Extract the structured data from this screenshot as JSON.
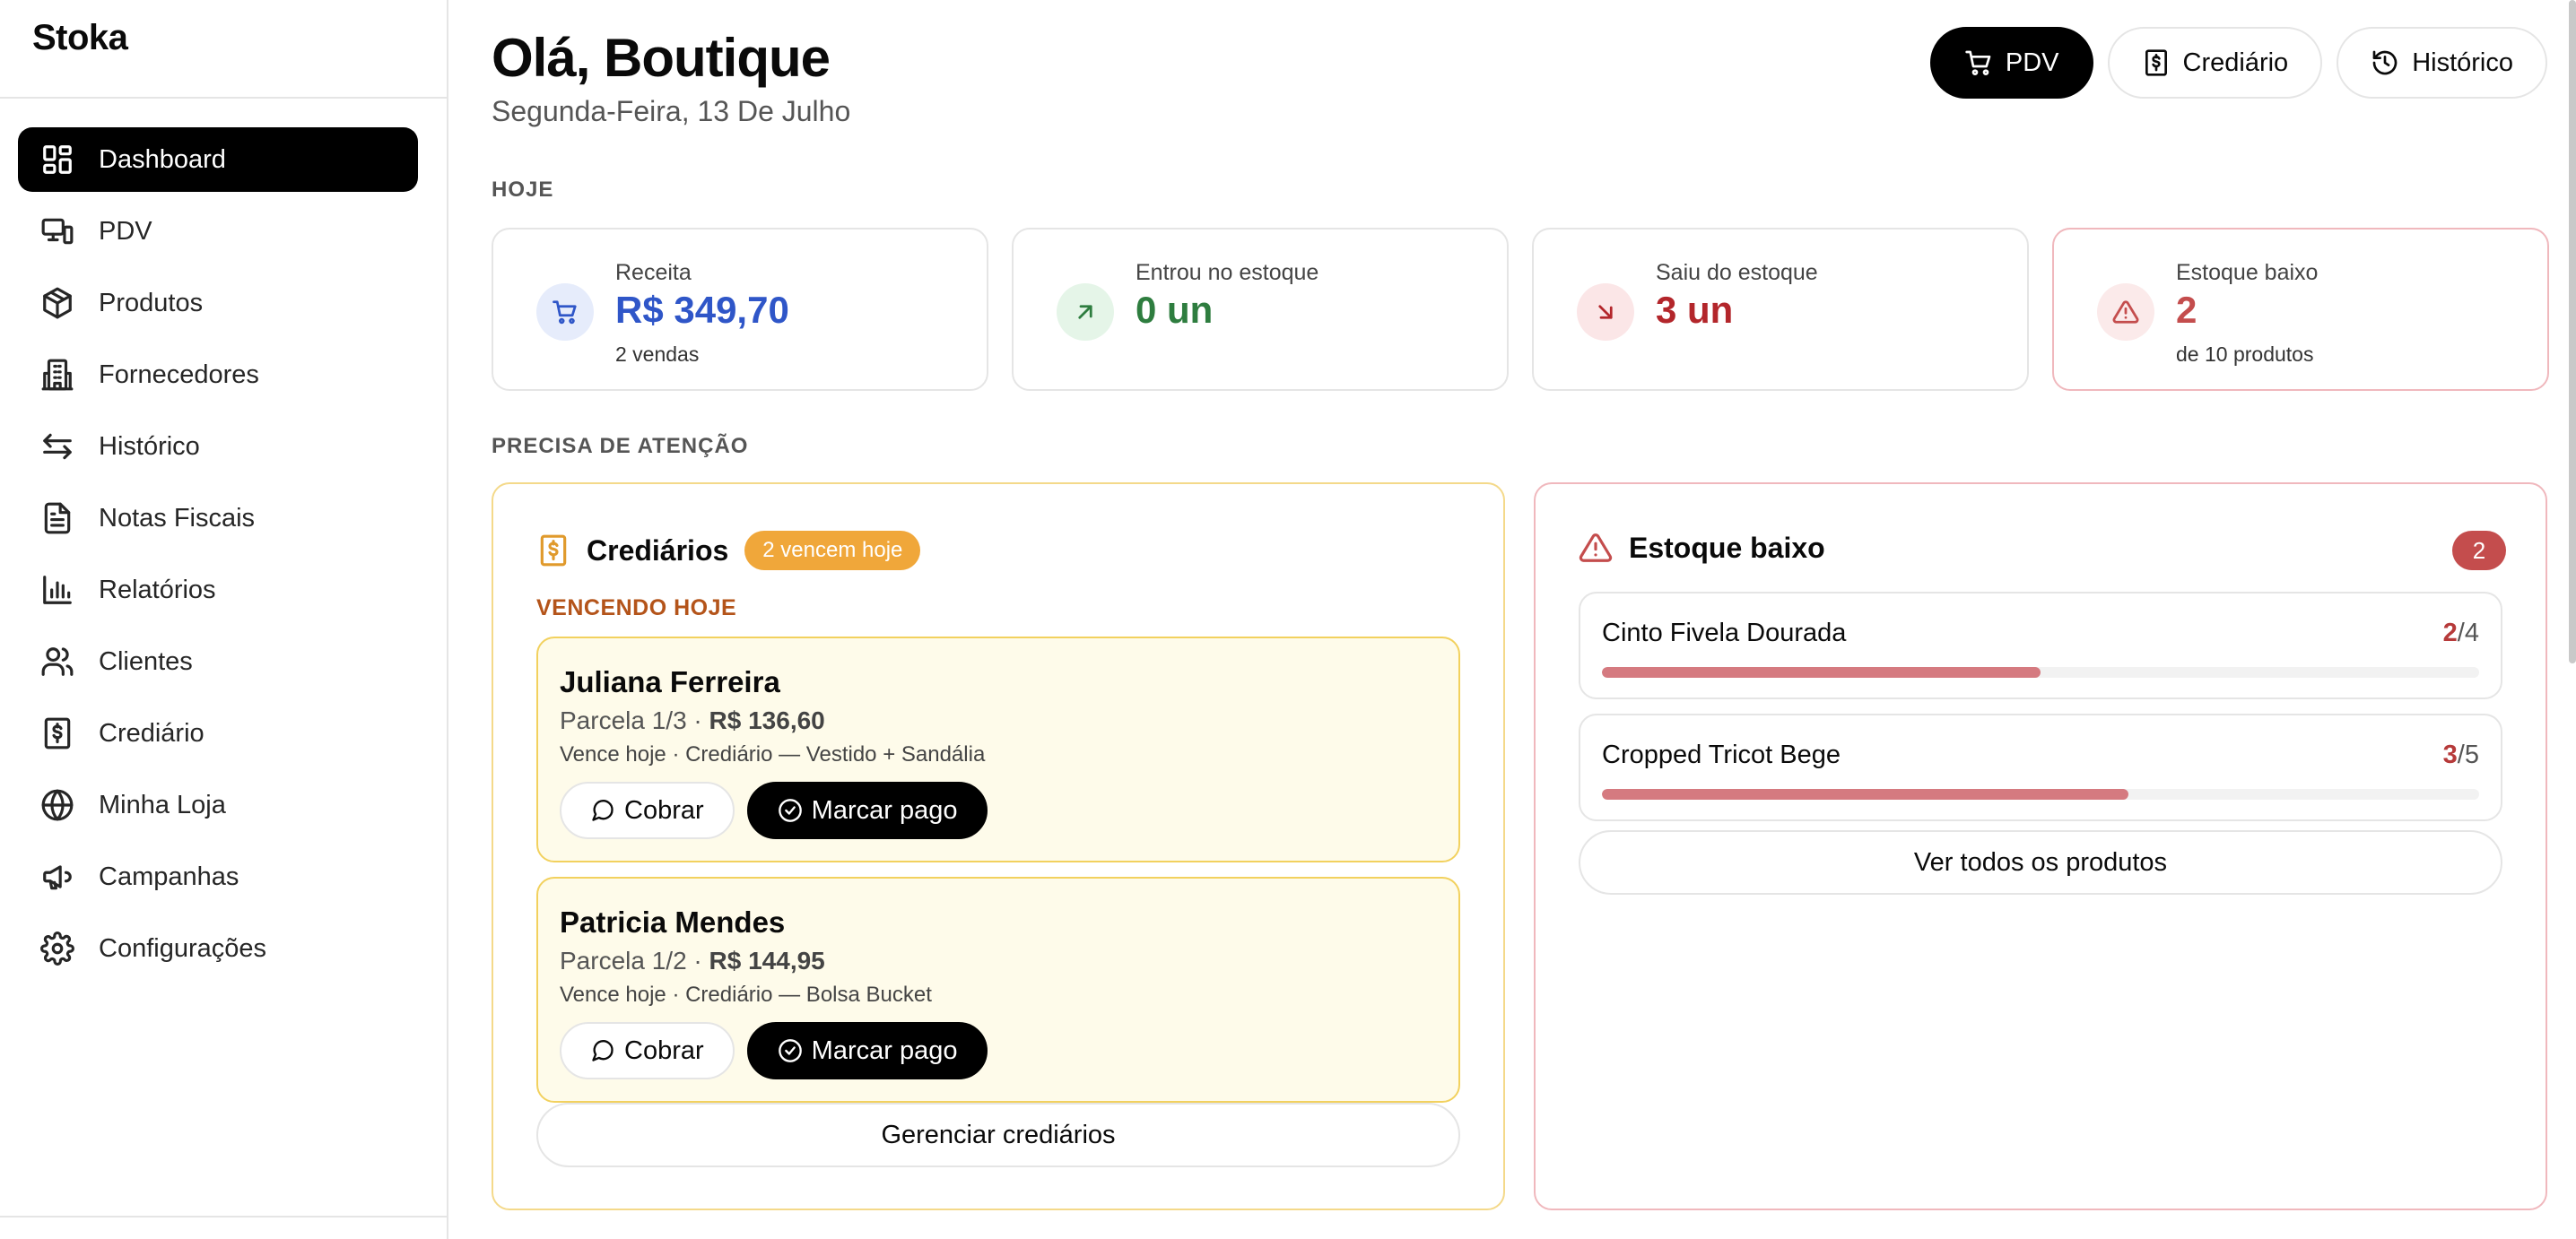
{
  "app": {
    "brand": "Stoka"
  },
  "sidebar": {
    "items": [
      {
        "label": "Dashboard",
        "icon": "dashboard-icon",
        "active": true
      },
      {
        "label": "PDV",
        "icon": "pos-icon"
      },
      {
        "label": "Produtos",
        "icon": "package-icon"
      },
      {
        "label": "Fornecedores",
        "icon": "building-icon"
      },
      {
        "label": "Histórico",
        "icon": "arrows-exchange-icon"
      },
      {
        "label": "Notas Fiscais",
        "icon": "document-icon"
      },
      {
        "label": "Relatórios",
        "icon": "bar-chart-icon"
      },
      {
        "label": "Clientes",
        "icon": "users-icon"
      },
      {
        "label": "Crediário",
        "icon": "receipt-dollar-icon"
      },
      {
        "label": "Minha Loja",
        "icon": "globe-icon"
      },
      {
        "label": "Campanhas",
        "icon": "megaphone-icon"
      },
      {
        "label": "Configurações",
        "icon": "gear-icon"
      }
    ]
  },
  "header": {
    "greeting": "Olá, Boutique",
    "date": "Segunda-Feira, 13 De Julho",
    "actions": {
      "pdv": "PDV",
      "crediario": "Crediário",
      "historico": "Histórico"
    }
  },
  "today": {
    "section_label": "HOJE",
    "stats": [
      {
        "label": "Receita",
        "value": "R$ 349,70",
        "sub": "2 vendas",
        "icon": "cart-icon",
        "color": "#2f56c8",
        "icon_bg": "#e6ecfb"
      },
      {
        "label": "Entrou no estoque",
        "value": "0 un",
        "sub": "",
        "icon": "arrow-up-right-icon",
        "color": "#2e7d3f",
        "icon_bg": "#e5f5e8"
      },
      {
        "label": "Saiu do estoque",
        "value": "3 un",
        "sub": "",
        "icon": "arrow-down-right-icon",
        "color": "#b3262b",
        "icon_bg": "#fbe6e7"
      },
      {
        "label": "Estoque baixo",
        "value": "2",
        "sub": "de 10 produtos",
        "icon": "alert-triangle-icon",
        "color": "#c44d4d",
        "icon_bg": "#fbeaea"
      }
    ]
  },
  "attention": {
    "section_label": "PRECISA DE ATENÇÃO",
    "crediarios": {
      "title": "Crediários",
      "badge": "2 vencem hoje",
      "due_label": "VENCENDO HOJE",
      "items": [
        {
          "name": "Juliana Ferreira",
          "parcela": "Parcela 1/3 · ",
          "amount": "R$ 136,60",
          "desc": "Vence hoje · Crediário — Vestido + Sandália",
          "charge_label": "Cobrar",
          "paid_label": "Marcar pago"
        },
        {
          "name": "Patricia Mendes",
          "parcela": "Parcela 1/2 · ",
          "amount": "R$ 144,95",
          "desc": "Vence hoje · Crediário — Bolsa Bucket",
          "charge_label": "Cobrar",
          "paid_label": "Marcar pago"
        }
      ],
      "manage_label": "Gerenciar crediários"
    },
    "low_stock": {
      "title": "Estoque baixo",
      "count": "2",
      "items": [
        {
          "name": "Cinto Fivela Dourada",
          "current": "2",
          "separator": "/",
          "min": "4",
          "level": 0.5
        },
        {
          "name": "Cropped Tricot Bege",
          "current": "3",
          "separator": "/",
          "min": "5",
          "level": 0.6
        }
      ],
      "view_all_label": "Ver todos os produtos"
    }
  }
}
